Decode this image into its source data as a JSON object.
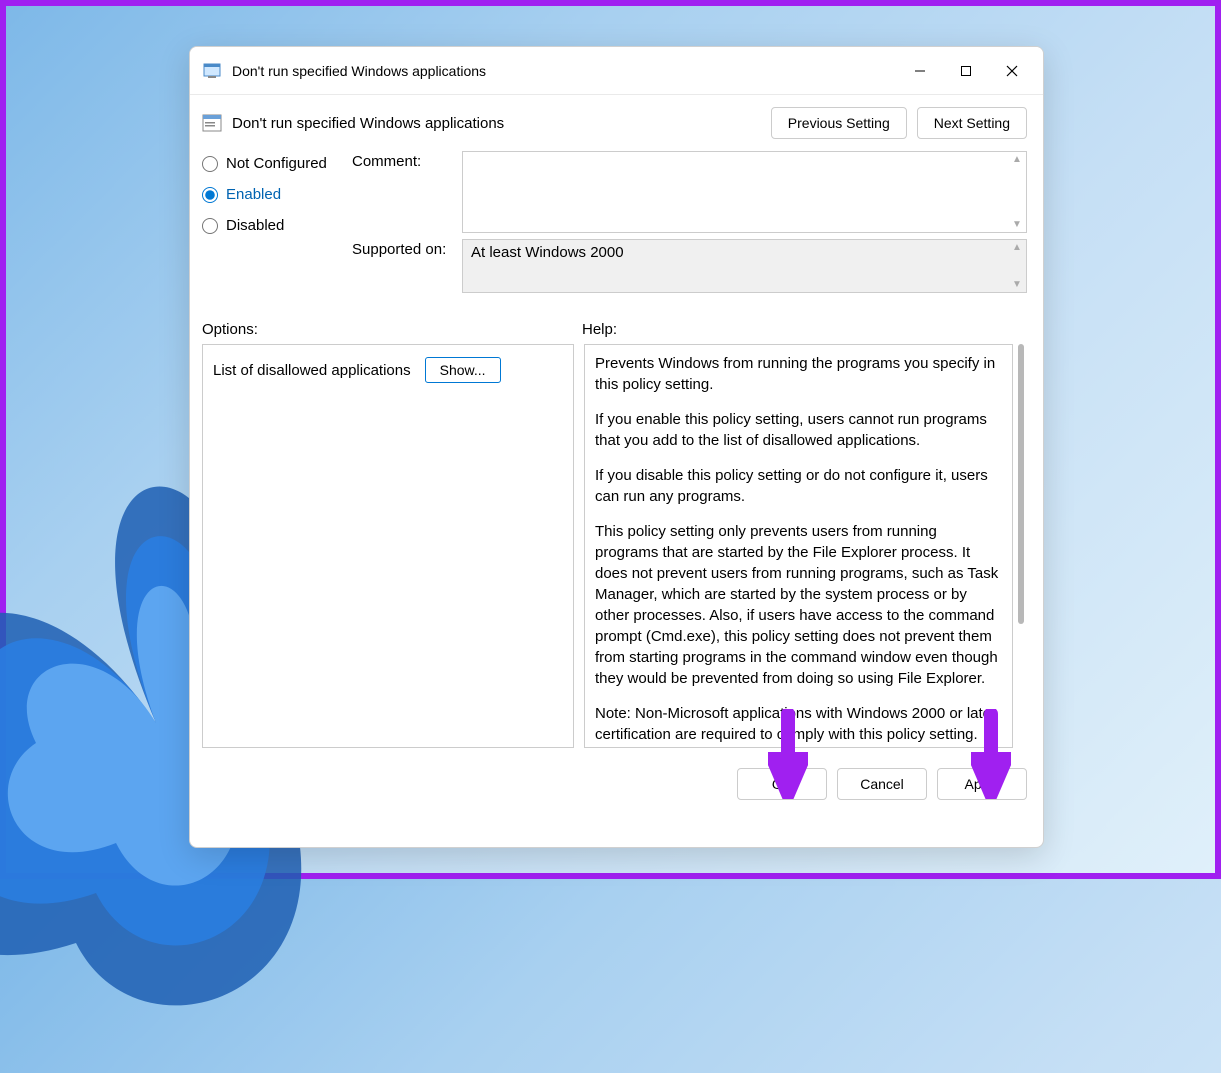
{
  "window": {
    "title": "Don't run specified Windows applications"
  },
  "header": {
    "title": "Don't run specified Windows applications",
    "prev_btn": "Previous Setting",
    "next_btn": "Next Setting"
  },
  "radios": {
    "not_configured": "Not Configured",
    "enabled": "Enabled",
    "disabled": "Disabled",
    "selected": "enabled"
  },
  "fields": {
    "comment_label": "Comment:",
    "comment_value": "",
    "supported_label": "Supported on:",
    "supported_value": "At least Windows 2000"
  },
  "sections": {
    "options_label": "Options:",
    "help_label": "Help:"
  },
  "options": {
    "list_label": "List of disallowed applications",
    "show_btn": "Show..."
  },
  "help": {
    "p1": "Prevents Windows from running the programs you specify in this policy setting.",
    "p2": "If you enable this policy setting, users cannot run programs that you add to the list of disallowed applications.",
    "p3": "If you disable this policy setting or do not configure it, users can run any programs.",
    "p4": "This policy setting only prevents users from running programs that are started by the File Explorer process. It does not prevent users from running programs, such as Task Manager, which are started by the system process or by other processes.  Also, if users have access to the command prompt (Cmd.exe), this policy setting does not prevent them from starting programs in the command window even though they would be prevented from doing so using File Explorer.",
    "p5": "Note: Non-Microsoft applications with Windows 2000 or later certification are required to comply with this policy setting."
  },
  "footer": {
    "ok": "OK",
    "cancel": "Cancel",
    "apply": "Apply"
  }
}
